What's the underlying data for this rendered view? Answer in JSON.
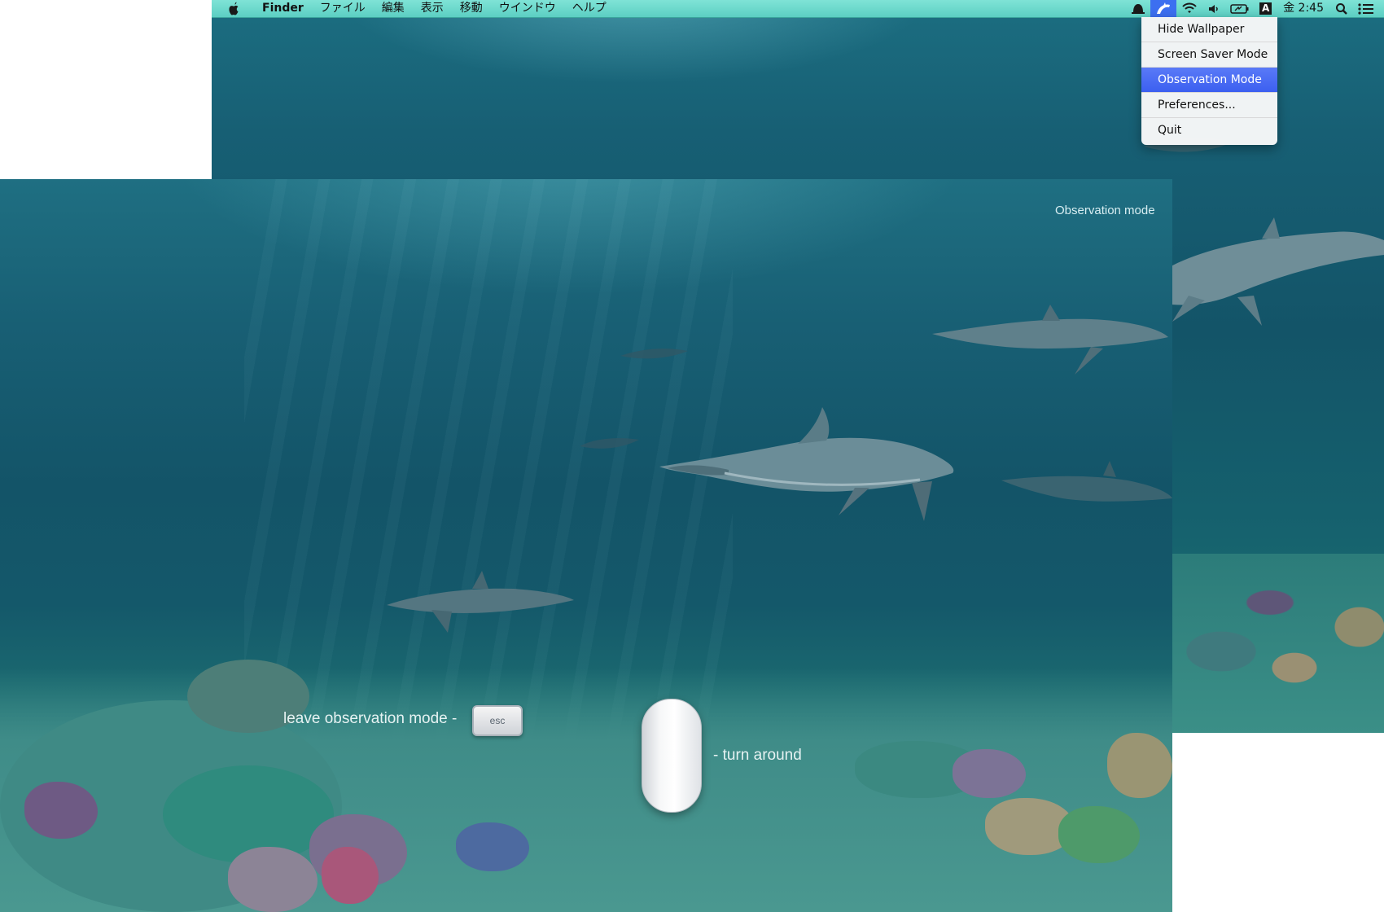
{
  "menubar": {
    "app_name": "Finder",
    "menus": [
      "ファイル",
      "編集",
      "表示",
      "移動",
      "ウインドウ",
      "ヘルプ"
    ],
    "clock": "金 2:45",
    "status_icons": [
      "notification-icon",
      "dolphin-app-icon",
      "wifi-icon",
      "volume-icon",
      "battery-icon",
      "input-method-icon",
      "spotlight-icon",
      "list-icon"
    ],
    "input_method_letter": "A"
  },
  "dropdown": {
    "items": [
      {
        "label": "Hide Wallpaper",
        "selected": false
      },
      {
        "label": "Screen Saver Mode",
        "selected": false
      },
      {
        "label": "Observation Mode",
        "selected": true
      },
      {
        "label": "Preferences...",
        "selected": false
      },
      {
        "label": "Quit",
        "selected": false
      }
    ]
  },
  "scene": {
    "mode_label": "Observation mode",
    "leave_hint": "leave observation mode -",
    "esc_key": "esc",
    "turn_hint": "- turn around"
  },
  "colors": {
    "menubar": "#6ad8cc",
    "highlight": "#3c5ff0",
    "water": "#135468"
  }
}
